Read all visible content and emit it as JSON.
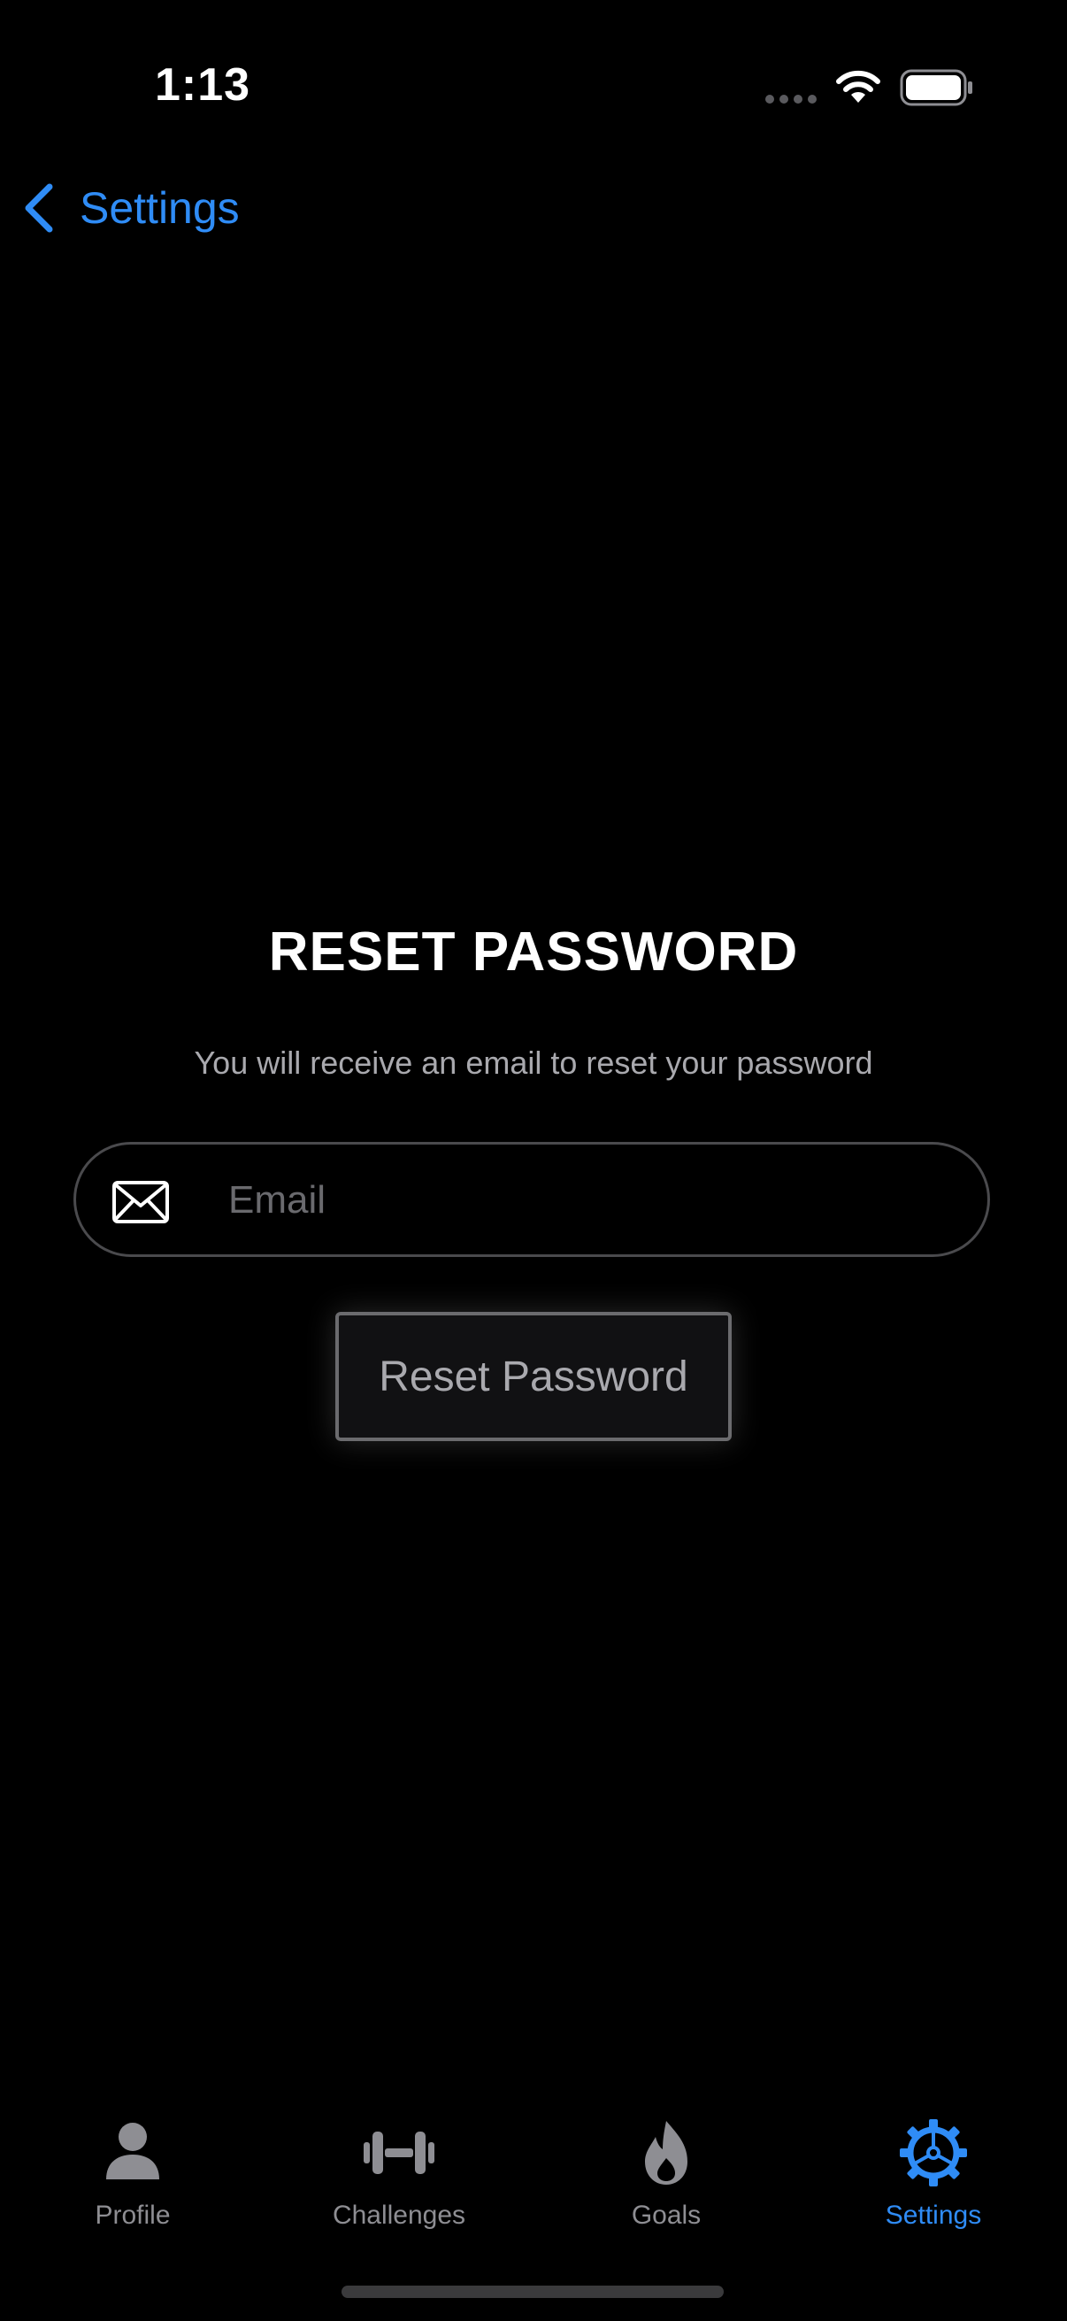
{
  "status_bar": {
    "time": "1:13"
  },
  "nav": {
    "back_label": "Settings"
  },
  "reset": {
    "title": "RESET PASSWORD",
    "subtitle": "You will receive an email to reset your password",
    "email_value": "",
    "email_placeholder": "Email",
    "button_label": "Reset Password"
  },
  "tabs": [
    {
      "label": "Profile",
      "icon": "person-icon",
      "active": false
    },
    {
      "label": "Challenges",
      "icon": "dumbbell-icon",
      "active": false
    },
    {
      "label": "Goals",
      "icon": "flame-icon",
      "active": false
    },
    {
      "label": "Settings",
      "icon": "gear-icon",
      "active": true
    }
  ],
  "colors": {
    "accent": "#2f8cf6",
    "background": "#000000",
    "inactive": "#8e8e93",
    "subtitle": "#a9a9ae"
  }
}
